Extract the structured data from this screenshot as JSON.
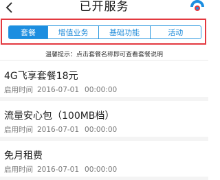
{
  "header": {
    "title": "已开服务",
    "back_icon": "chevron-left-icon",
    "service_icon": "service-logo-icon"
  },
  "tabs": [
    {
      "label": "套餐",
      "active": true
    },
    {
      "label": "增值业务",
      "active": false
    },
    {
      "label": "基础功能",
      "active": false
    },
    {
      "label": "活动",
      "active": false
    }
  ],
  "tip": "温馨提示：点击套餐名称即可查看套餐说明",
  "items": [
    {
      "name": "4G飞享套餐18元",
      "time_label": "启用时间",
      "date": "2016-07-01",
      "clock": "00:00:00"
    },
    {
      "name": "流量安心包（100MB档）",
      "time_label": "启用时间",
      "date": "2016-07-01",
      "clock": "00:00:00"
    },
    {
      "name": "免月租费",
      "time_label": "启用时间",
      "date": "2016-07-01",
      "clock": "00:00:00"
    }
  ],
  "colors": {
    "accent": "#1c8ee0",
    "highlight_border": "#e3383f",
    "list_background": "#f4f4f4"
  }
}
